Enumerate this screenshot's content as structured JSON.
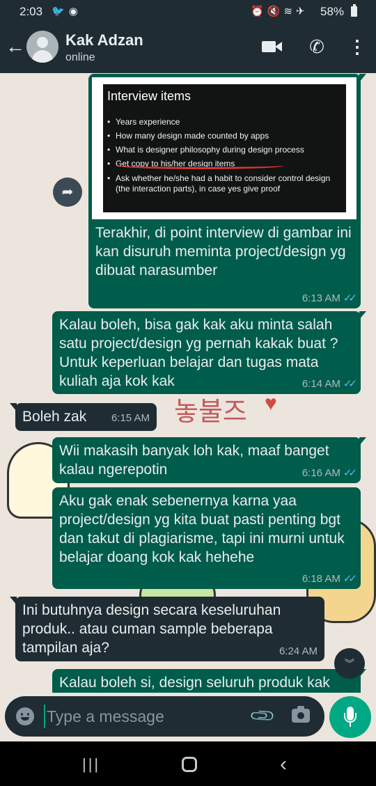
{
  "status_bar": {
    "time": "2:03",
    "left_icons": [
      "twitter-icon",
      "spotify-icon"
    ],
    "right_icons": [
      "alarm-icon",
      "mute-icon",
      "wifi-icon",
      "airplane-icon"
    ],
    "battery": "58%"
  },
  "header": {
    "contact_name": "Kak Adzan",
    "presence": "online"
  },
  "slide": {
    "title": "Interview items",
    "items": [
      "Years experience",
      "How many design made counted by apps",
      "What is designer philosophy during design process",
      "Get copy to his/her design items",
      "Ask whether he/she had a habit to consider control design (the interaction parts), in case yes give proof"
    ]
  },
  "messages": [
    {
      "direction": "out",
      "text": "Terakhir, di point interview di gambar ini kan disuruh meminta project/design yg dibuat narasumber",
      "time": "6:13 AM",
      "ticks": "✓✓"
    },
    {
      "direction": "out",
      "text": "Kalau boleh, bisa gak kak aku minta salah satu project/design yg pernah kakak buat ? Untuk keperluan belajar dan tugas mata kuliah aja kok kak",
      "time": "6:14 AM",
      "ticks": "✓✓"
    },
    {
      "direction": "in",
      "text": "Boleh zak",
      "time": "6:15 AM"
    },
    {
      "direction": "out",
      "text": "Wii makasih banyak loh kak, maaf banget kalau ngerepotin",
      "time": "6:16 AM",
      "ticks": "✓✓"
    },
    {
      "direction": "out",
      "text": "Aku gak enak sebenernya karna yaa project/design yg kita buat pasti penting bgt dan takut di plagiarisme, tapi ini murni untuk belajar doang kok kak hehehe",
      "time": "6:18 AM",
      "ticks": "✓✓"
    },
    {
      "direction": "in",
      "text": "Ini butuhnya design secara keseluruhan produk.. atau cuman sample beberapa tampilan aja?",
      "time": "6:24 AM"
    },
    {
      "direction": "out",
      "text": "Kalau boleh si, design seluruh produk kak"
    }
  ],
  "wallpaper": {
    "korean_text": "놓불즈",
    "heart": "♥"
  },
  "composer": {
    "placeholder": "Type a message",
    "value": ""
  },
  "colors": {
    "header_bg": "#1f2c33",
    "outgoing_bubble": "#005c4b",
    "incoming_bubble": "#1f2c33",
    "accent": "#00a884",
    "read_ticks": "#53bdeb"
  }
}
